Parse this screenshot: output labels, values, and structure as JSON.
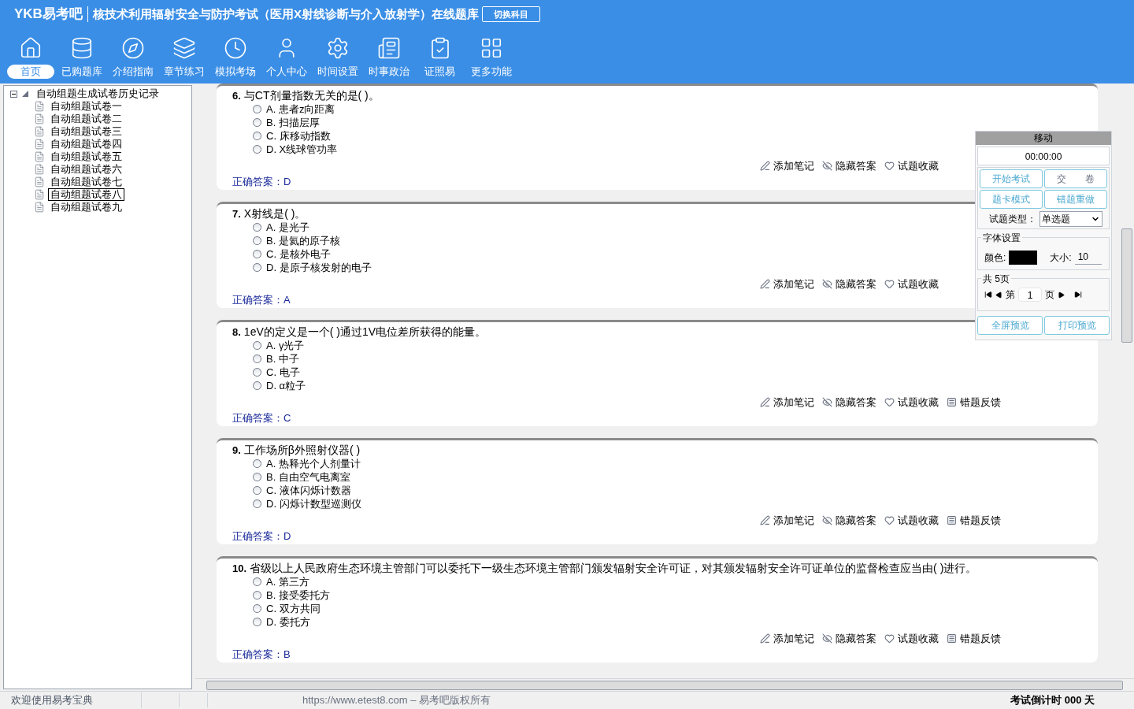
{
  "header": {
    "logo": "YKB易考吧",
    "title": "核技术利用辐射安全与防护考试（医用X射线诊断与介入放射学）在线题库",
    "switch_button": "切换科目"
  },
  "nav": [
    {
      "label": "首页",
      "selected": true
    },
    {
      "label": "已购题库",
      "selected": false
    },
    {
      "label": "介绍指南",
      "selected": false
    },
    {
      "label": "章节练习",
      "selected": false
    },
    {
      "label": "模拟考场",
      "selected": false
    },
    {
      "label": "个人中心",
      "selected": false
    },
    {
      "label": "时间设置",
      "selected": false
    },
    {
      "label": "时事政治",
      "selected": false
    },
    {
      "label": "证照易",
      "selected": false
    },
    {
      "label": "更多功能",
      "selected": false
    }
  ],
  "tree": {
    "label": "自动组题生成试卷历史记录",
    "expanded": true,
    "children": [
      {
        "label": "自动组题试卷一",
        "selected": false
      },
      {
        "label": "自动组题试卷二",
        "selected": false
      },
      {
        "label": "自动组题试卷三",
        "selected": false
      },
      {
        "label": "自动组题试卷四",
        "selected": false
      },
      {
        "label": "自动组题试卷五",
        "selected": false
      },
      {
        "label": "自动组题试卷六",
        "selected": false
      },
      {
        "label": "自动组题试卷七",
        "selected": false
      },
      {
        "label": "自动组题试卷八",
        "selected": true
      },
      {
        "label": "自动组题试卷九",
        "selected": false
      }
    ]
  },
  "questions": [
    {
      "number": "6.",
      "text": "与CT剂量指数无关的是( )。",
      "options": [
        {
          "label": "A. 患者z向距离",
          "selected": false
        },
        {
          "label": "B. 扫描层厚",
          "selected": false
        },
        {
          "label": "C. 床移动指数",
          "selected": false
        },
        {
          "label": "D. X线球管功率",
          "selected": false
        }
      ],
      "actions": [
        "添加笔记",
        "隐藏答案",
        "试题收藏"
      ],
      "answer": "正确答案：D"
    },
    {
      "number": "7.",
      "text": "X射线是( )。",
      "options": [
        {
          "label": "A. 是光子",
          "selected": false
        },
        {
          "label": "B. 是氦的原子核",
          "selected": false
        },
        {
          "label": "C. 是核外电子",
          "selected": false
        },
        {
          "label": "D. 是原子核发射的电子",
          "selected": false
        }
      ],
      "actions": [
        "添加笔记",
        "隐藏答案",
        "试题收藏"
      ],
      "answer": "正确答案：A"
    },
    {
      "number": "8.",
      "text": "1eV的定义是一个( )通过1V电位差所获得的能量。",
      "options": [
        {
          "label": "A. γ光子",
          "selected": false
        },
        {
          "label": "B. 中子",
          "selected": false
        },
        {
          "label": "C. 电子",
          "selected": false
        },
        {
          "label": "D. α粒子",
          "selected": false
        }
      ],
      "actions": [
        "添加笔记",
        "隐藏答案",
        "试题收藏",
        "错题反馈"
      ],
      "answer": "正确答案：C"
    },
    {
      "number": "9.",
      "text": "工作场所β外照射仪器( )",
      "options": [
        {
          "label": "A. 热释光个人剂量计",
          "selected": false
        },
        {
          "label": "B. 自由空气电离室",
          "selected": false
        },
        {
          "label": "C. 液体闪烁计数器",
          "selected": false
        },
        {
          "label": "D. 闪烁计数型巡测仪",
          "selected": false
        }
      ],
      "actions": [
        "添加笔记",
        "隐藏答案",
        "试题收藏",
        "错题反馈"
      ],
      "answer": "正确答案：D"
    },
    {
      "number": "10.",
      "text": "省级以上人民政府生态环境主管部门可以委托下一级生态环境主管部门颁发辐射安全许可证，对其颁发辐射安全许可证单位的监督检查应当由( )进行。",
      "options": [
        {
          "label": "A. 第三方",
          "selected": false
        },
        {
          "label": "B. 接受委托方",
          "selected": false
        },
        {
          "label": "C. 双方共同",
          "selected": false
        },
        {
          "label": "D. 委托方",
          "selected": false
        }
      ],
      "actions": [
        "添加笔记",
        "隐藏答案",
        "试题收藏",
        "错题反馈"
      ],
      "answer": "正确答案：B"
    }
  ],
  "panel": {
    "title": "移动",
    "timer": "00:00:00",
    "buttons": [
      "开始考试",
      "交　　卷",
      "题卡模式",
      "错题重做"
    ],
    "type_label": "试题类型：",
    "type_value": "单选题",
    "font": {
      "legend": "字体设置",
      "color_label": "颜色:",
      "color": "#000000",
      "size_label": "大小:",
      "size": "10"
    },
    "pages": {
      "legend": "共 5页",
      "page_prefix": "第",
      "page": "1",
      "page_suffix": "页"
    },
    "bottom_buttons": [
      "全屏预览",
      "打印预览"
    ]
  },
  "status_bar": {
    "welcome": "欢迎使用易考宝典",
    "copyright": "https://www.etest8.com – 易考吧版权所有",
    "countdown": "考试倒计时 000 天"
  }
}
